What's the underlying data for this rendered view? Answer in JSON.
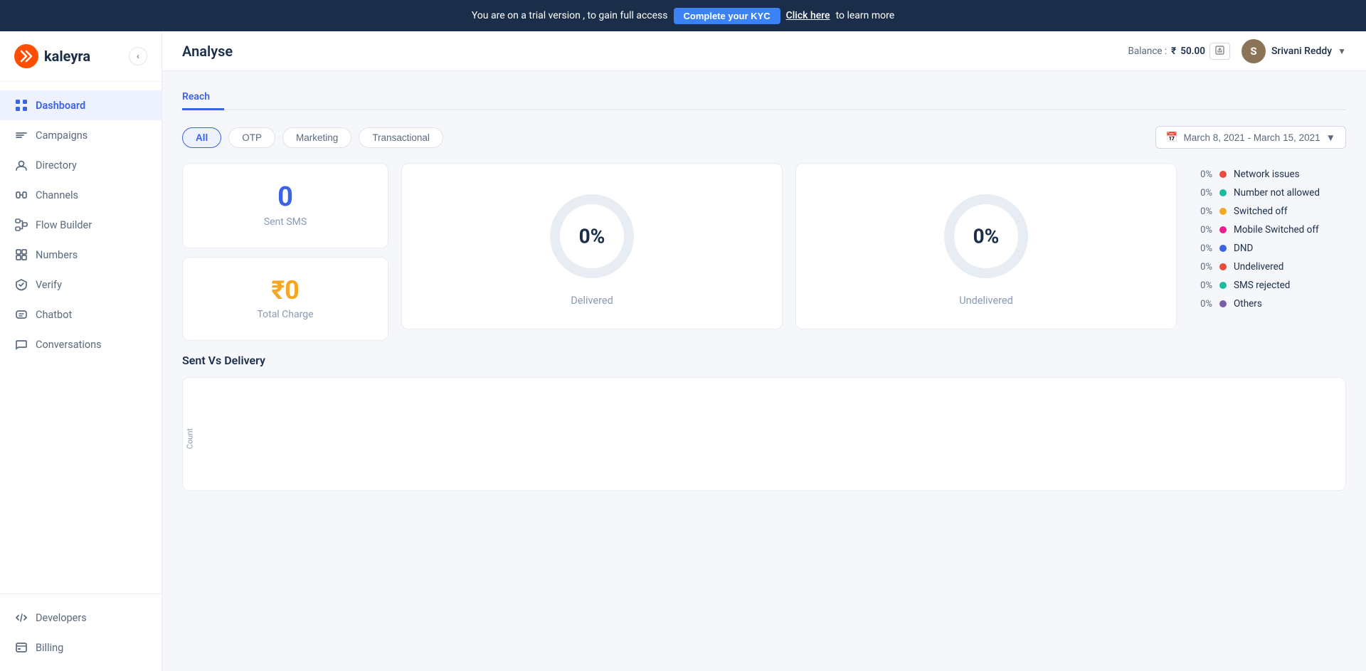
{
  "banner": {
    "text": "You are on a trial version , to gain full access",
    "kyc_label": "Complete your KYC",
    "learn_more": "Click here",
    "learn_more_suffix": " to learn more"
  },
  "sidebar": {
    "logo_text": "kaleyra",
    "nav_items": [
      {
        "id": "dashboard",
        "label": "Dashboard",
        "active": true
      },
      {
        "id": "campaigns",
        "label": "Campaigns",
        "active": false
      },
      {
        "id": "directory",
        "label": "Directory",
        "active": false
      },
      {
        "id": "channels",
        "label": "Channels",
        "active": false
      },
      {
        "id": "flow-builder",
        "label": "Flow Builder",
        "active": false
      },
      {
        "id": "numbers",
        "label": "Numbers",
        "active": false
      },
      {
        "id": "verify",
        "label": "Verify",
        "active": false
      },
      {
        "id": "chatbot",
        "label": "Chatbot",
        "active": false
      },
      {
        "id": "conversations",
        "label": "Conversations",
        "active": false
      }
    ],
    "bottom_items": [
      {
        "id": "developers",
        "label": "Developers"
      },
      {
        "id": "billing",
        "label": "Billing"
      }
    ]
  },
  "header": {
    "page_title": "Analyse",
    "balance_label": "Balance :",
    "balance_currency": "₹",
    "balance_amount": "50.00",
    "user_initial": "S",
    "user_name": "Srivani Reddy"
  },
  "page": {
    "tabs": [
      {
        "id": "reach",
        "label": "Reach",
        "active": true
      }
    ],
    "filters": [
      {
        "id": "all",
        "label": "All",
        "active": true
      },
      {
        "id": "otp",
        "label": "OTP",
        "active": false
      },
      {
        "id": "marketing",
        "label": "Marketing",
        "active": false
      },
      {
        "id": "transactional",
        "label": "Transactional",
        "active": false
      }
    ],
    "date_range": "March 8, 2021 - March 15, 2021",
    "stats": {
      "sent_sms_value": "0",
      "sent_sms_label": "Sent SMS",
      "total_charge_value": "₹0",
      "total_charge_label": "Total Charge",
      "delivered_pct": "0%",
      "delivered_label": "Delivered",
      "undelivered_pct": "0%",
      "undelivered_label": "Undelivered"
    },
    "legend": [
      {
        "label": "Network issues",
        "pct": "0%",
        "color": "#e74c3c"
      },
      {
        "label": "Number not allowed",
        "pct": "0%",
        "color": "#1abc9c"
      },
      {
        "label": "Switched off",
        "pct": "0%",
        "color": "#f5a623"
      },
      {
        "label": "Mobile Switched off",
        "pct": "0%",
        "color": "#e91e8c"
      },
      {
        "label": "DND",
        "pct": "0%",
        "color": "#3b63e8"
      },
      {
        "label": "Undelivered",
        "pct": "0%",
        "color": "#e74c3c"
      },
      {
        "label": "SMS rejected",
        "pct": "0%",
        "color": "#1abc9c"
      },
      {
        "label": "Others",
        "pct": "0%",
        "color": "#7b5ea7"
      }
    ],
    "sent_vs_delivery_title": "Sent Vs Delivery",
    "chart_y_label": "Count"
  }
}
